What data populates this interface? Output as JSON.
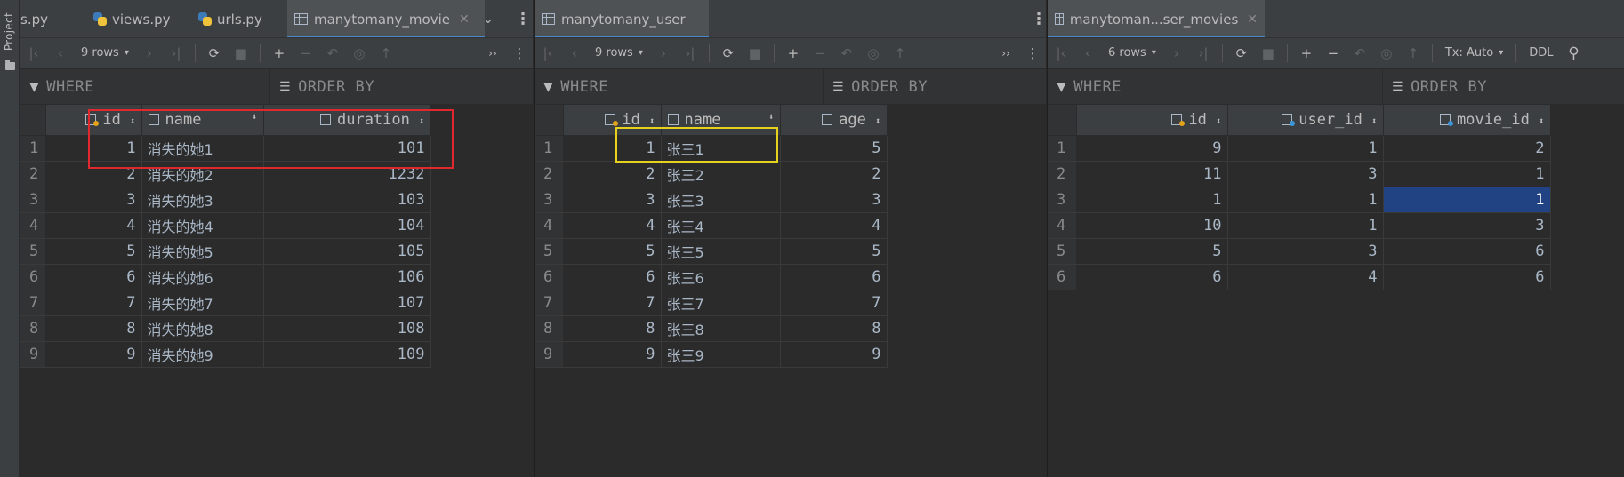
{
  "sidebar": {
    "project_label": "Project"
  },
  "panes": [
    {
      "tabs": [
        {
          "label": "s.py",
          "icon": "python-file-icon"
        },
        {
          "label": "views.py",
          "icon": "python-file-icon"
        },
        {
          "label": "urls.py",
          "icon": "python-file-icon"
        },
        {
          "label": "manytomany_movie",
          "icon": "table-icon",
          "active": true,
          "close": "✕"
        }
      ],
      "toolbar": {
        "rows": "9 rows"
      },
      "filter": {
        "where": "WHERE",
        "order_by": "ORDER BY"
      },
      "columns": [
        "id",
        "name",
        "duration"
      ],
      "rows": [
        [
          "1",
          "1",
          "消失的她1",
          "101"
        ],
        [
          "2",
          "2",
          "消失的她2",
          "1232"
        ],
        [
          "3",
          "3",
          "消失的她3",
          "103"
        ],
        [
          "4",
          "4",
          "消失的她4",
          "104"
        ],
        [
          "5",
          "5",
          "消失的她5",
          "105"
        ],
        [
          "6",
          "6",
          "消失的她6",
          "106"
        ],
        [
          "7",
          "7",
          "消失的她7",
          "107"
        ],
        [
          "8",
          "8",
          "消失的她8",
          "108"
        ],
        [
          "9",
          "9",
          "消失的她9",
          "109"
        ]
      ]
    },
    {
      "tabs": [
        {
          "label": "manytomany_user",
          "icon": "table-icon",
          "active": true
        }
      ],
      "toolbar": {
        "rows": "9 rows"
      },
      "filter": {
        "where": "WHERE",
        "order_by": "ORDER BY"
      },
      "columns": [
        "id",
        "name",
        "age"
      ],
      "rows": [
        [
          "1",
          "1",
          "张三1",
          "5"
        ],
        [
          "2",
          "2",
          "张三2",
          "2"
        ],
        [
          "3",
          "3",
          "张三3",
          "3"
        ],
        [
          "4",
          "4",
          "张三4",
          "4"
        ],
        [
          "5",
          "5",
          "张三5",
          "5"
        ],
        [
          "6",
          "6",
          "张三6",
          "6"
        ],
        [
          "7",
          "7",
          "张三7",
          "7"
        ],
        [
          "8",
          "8",
          "张三8",
          "8"
        ],
        [
          "9",
          "9",
          "张三9",
          "9"
        ]
      ]
    },
    {
      "tabs": [
        {
          "label": "manytoman...ser_movies",
          "icon": "table-icon",
          "active": true,
          "close": "✕"
        }
      ],
      "toolbar": {
        "rows": "6 rows",
        "tx": "Tx: Auto",
        "ddl": "DDL"
      },
      "filter": {
        "where": "WHERE",
        "order_by": "ORDER BY"
      },
      "columns": [
        "id",
        "user_id",
        "movie_id"
      ],
      "rows": [
        [
          "1",
          "9",
          "1",
          "2"
        ],
        [
          "2",
          "11",
          "3",
          "1"
        ],
        [
          "3",
          "1",
          "1",
          "1"
        ],
        [
          "4",
          "10",
          "1",
          "3"
        ],
        [
          "5",
          "5",
          "3",
          "6"
        ],
        [
          "6",
          "6",
          "4",
          "6"
        ]
      ]
    }
  ],
  "colors": {
    "background": "#2b2b2b",
    "toolbar": "#3c3f41",
    "selection": "#214283",
    "red_highlight": "#e0282e",
    "yellow_highlight": "#e6d21c",
    "tab_underline": "#4a88c7"
  }
}
